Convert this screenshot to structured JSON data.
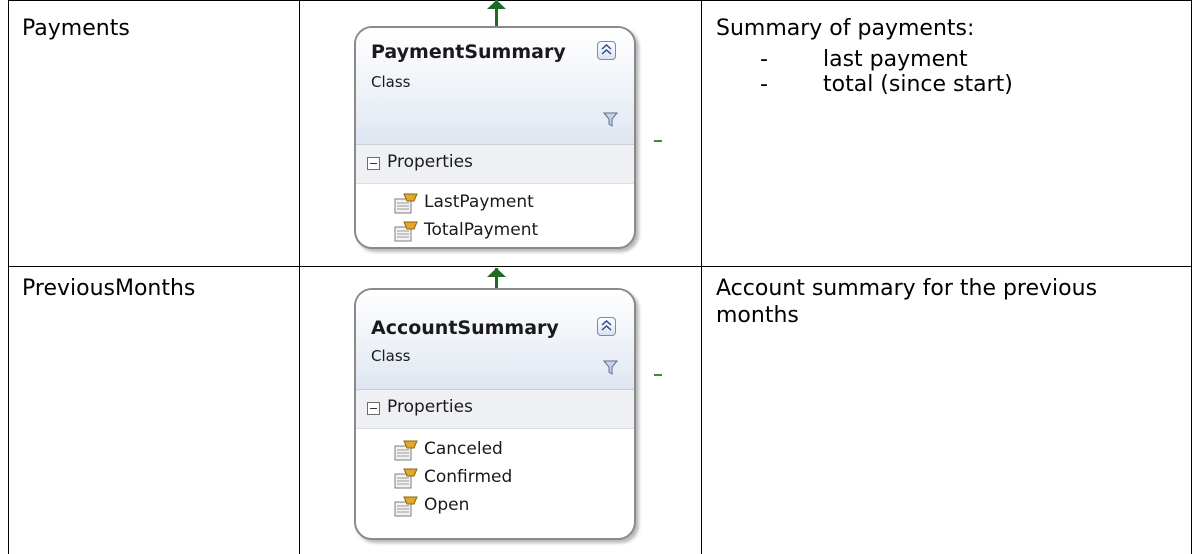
{
  "rows": [
    {
      "name": "Payments",
      "class": {
        "title": "PaymentSummary",
        "stereotype": "Class",
        "section": "Properties",
        "properties": [
          "LastPayment",
          "TotalPayment"
        ]
      },
      "description": {
        "heading": "Summary of payments:",
        "items": [
          {
            "dash": "-",
            "text": "last payment"
          },
          {
            "dash": "-",
            "text": "total (since start)"
          }
        ]
      }
    },
    {
      "name": "PreviousMonths",
      "class": {
        "title": "AccountSummary",
        "stereotype": "Class",
        "section": "Properties",
        "properties": [
          "Canceled",
          "Confirmed",
          "Open"
        ]
      },
      "description": {
        "heading": "Account summary for the previous months"
      }
    }
  ],
  "colors": {
    "connector": "#1f6b24",
    "border": "#8a8a8a",
    "header_gradient_end": "#dfe6f1"
  },
  "icons": {
    "collapse": "double-chevron-up-icon",
    "filter": "filter-icon",
    "property": "property-icon"
  }
}
